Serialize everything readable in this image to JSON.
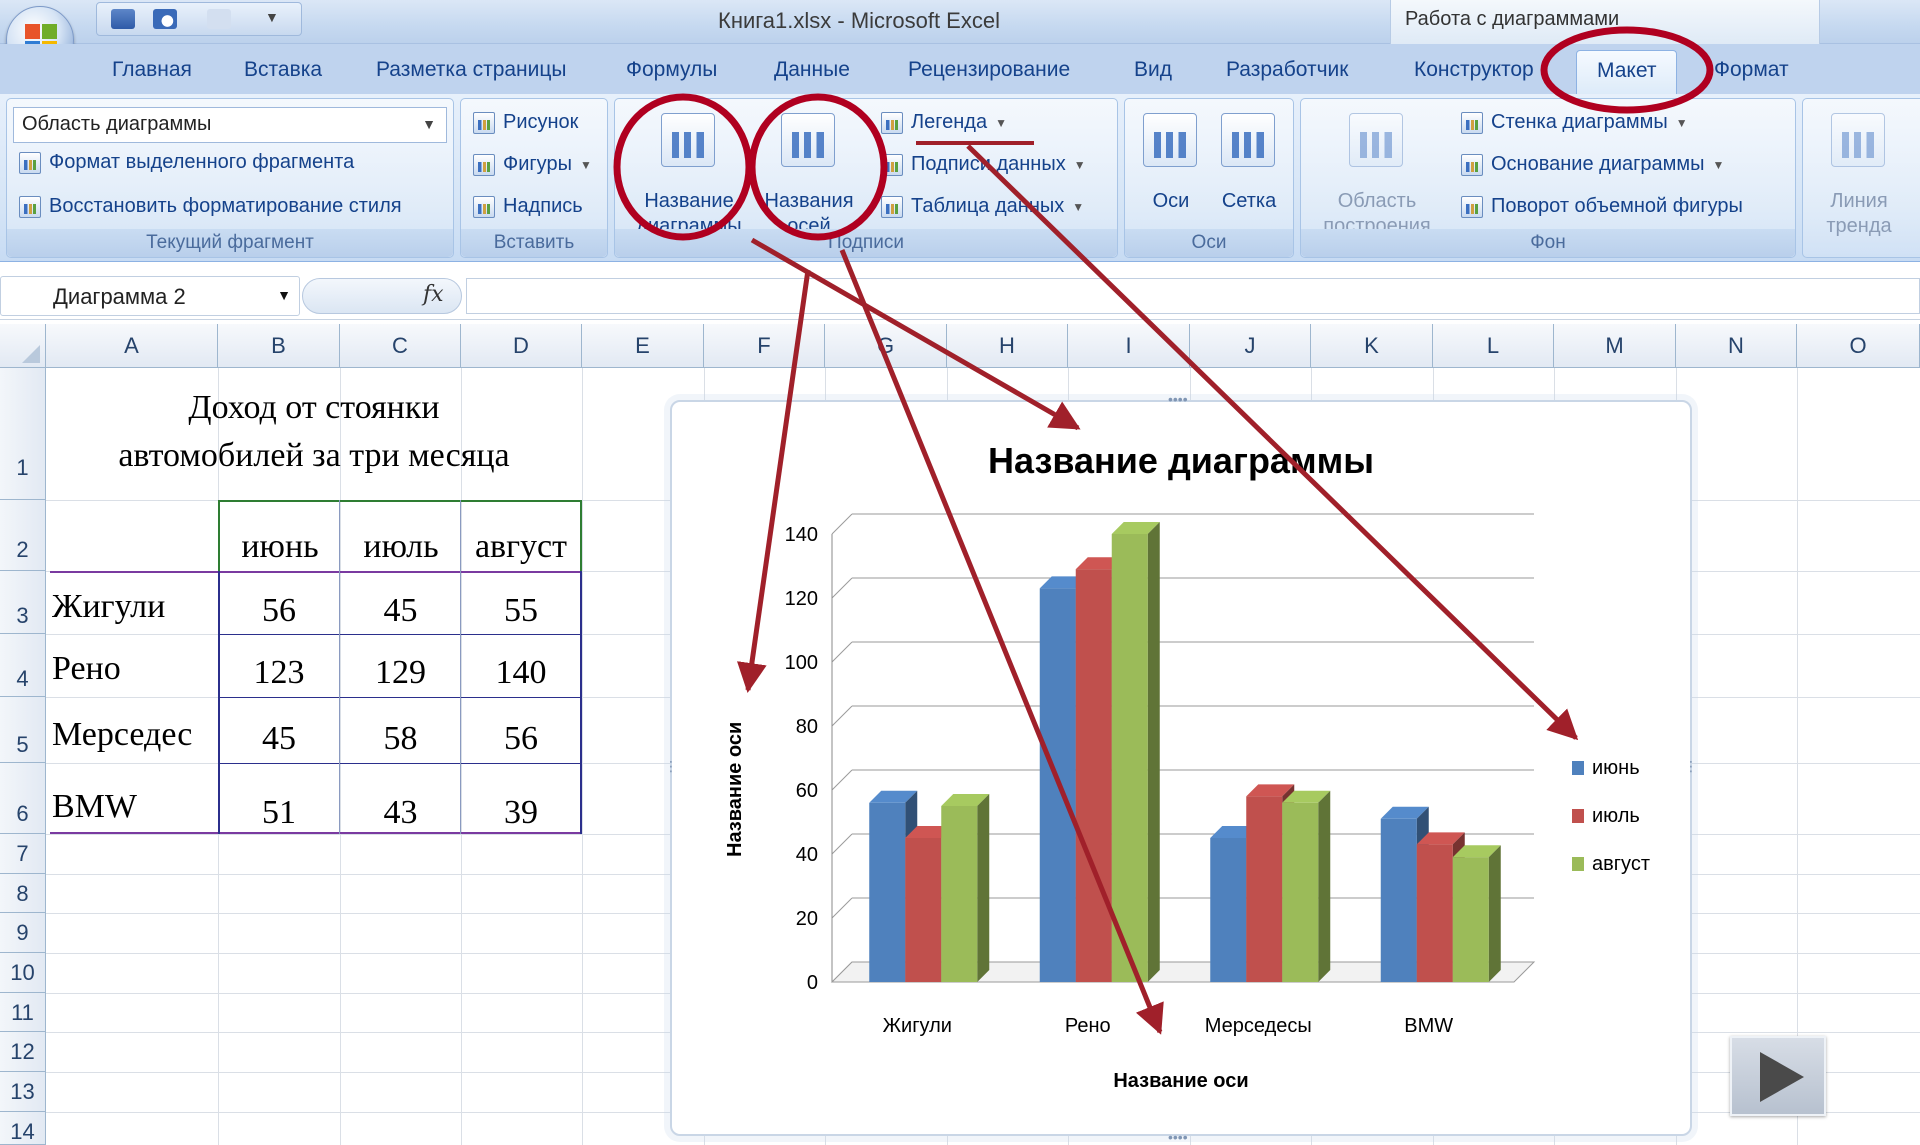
{
  "window": {
    "title": "Книга1.xlsx - Microsoft Excel",
    "context_title": "Работа с диаграммами"
  },
  "tabs": [
    {
      "label": "Главная"
    },
    {
      "label": "Вставка"
    },
    {
      "label": "Разметка страницы"
    },
    {
      "label": "Формулы"
    },
    {
      "label": "Данные"
    },
    {
      "label": "Рецензирование"
    },
    {
      "label": "Вид"
    },
    {
      "label": "Разработчик"
    },
    {
      "label": "Конструктор"
    },
    {
      "label": "Макет",
      "active": true
    },
    {
      "label": "Формат"
    }
  ],
  "ribbon": {
    "current_fragment": {
      "dropdown_value": "Область диаграммы",
      "format_selection": "Формат выделенного фрагмента",
      "reset_style": "Восстановить форматирование стиля",
      "label": "Текущий фрагмент"
    },
    "insert": {
      "picture": "Рисунок",
      "shapes": "Фигуры",
      "textbox": "Надпись",
      "label": "Вставить"
    },
    "labels": {
      "chart_title_line1": "Название",
      "chart_title_line2": "диаграммы",
      "axis_titles_line1": "Названия",
      "axis_titles_line2": "осей",
      "legend": "Легенда",
      "data_labels": "Подписи данных",
      "data_table": "Таблица данных",
      "label": "Подписи"
    },
    "axes": {
      "axes": "Оси",
      "gridlines": "Сетка",
      "label": "Оси"
    },
    "background": {
      "plot_area_line1": "Область",
      "plot_area_line2": "построения",
      "chart_wall": "Стенка диаграммы",
      "chart_floor": "Основание диаграммы",
      "rotation_3d": "Поворот объемной фигуры",
      "label": "Фон"
    },
    "analysis": {
      "trendline_line1": "Линия",
      "trendline_line2": "тренда"
    }
  },
  "formula_bar": {
    "name_box": "Диаграмма 2",
    "fx": "fx"
  },
  "columns": [
    "A",
    "B",
    "C",
    "D",
    "E",
    "F",
    "G",
    "H",
    "I",
    "J",
    "K",
    "L",
    "M",
    "N",
    "O"
  ],
  "rows": [
    "1",
    "2",
    "3",
    "4",
    "5",
    "6",
    "7",
    "8",
    "9",
    "10",
    "11",
    "12",
    "13",
    "14"
  ],
  "sheet": {
    "title_line1": "Доход от стоянки",
    "title_line2": "автомобилей за три месяца",
    "headers": [
      "июнь",
      "июль",
      "август"
    ],
    "table": [
      {
        "name": "Жигули",
        "values": [
          "56",
          "45",
          "55"
        ]
      },
      {
        "name": "Рено",
        "values": [
          "123",
          "129",
          "140"
        ]
      },
      {
        "name": "Мерседес",
        "values": [
          "45",
          "58",
          "56"
        ]
      },
      {
        "name": "BMW",
        "values": [
          "51",
          "43",
          "39"
        ]
      }
    ]
  },
  "chart_data": {
    "type": "bar",
    "title": "Название диаграммы",
    "xlabel": "Название оси",
    "ylabel": "Название оси",
    "categories": [
      "Жигули",
      "Рено",
      "Мерседесы",
      "BMW"
    ],
    "series": [
      {
        "name": "июнь",
        "values": [
          56,
          123,
          45,
          51
        ],
        "color": "#4f81bd"
      },
      {
        "name": "июль",
        "values": [
          45,
          129,
          58,
          43
        ],
        "color": "#c0504d"
      },
      {
        "name": "август",
        "values": [
          55,
          140,
          56,
          39
        ],
        "color": "#9bbb59"
      }
    ],
    "yticks": [
      0,
      20,
      40,
      60,
      80,
      100,
      120,
      140
    ],
    "ylim": [
      0,
      140
    ],
    "grid": true,
    "legend": "right",
    "style": "3d-clustered-column"
  },
  "annotations": {
    "color": "#a0202a"
  }
}
